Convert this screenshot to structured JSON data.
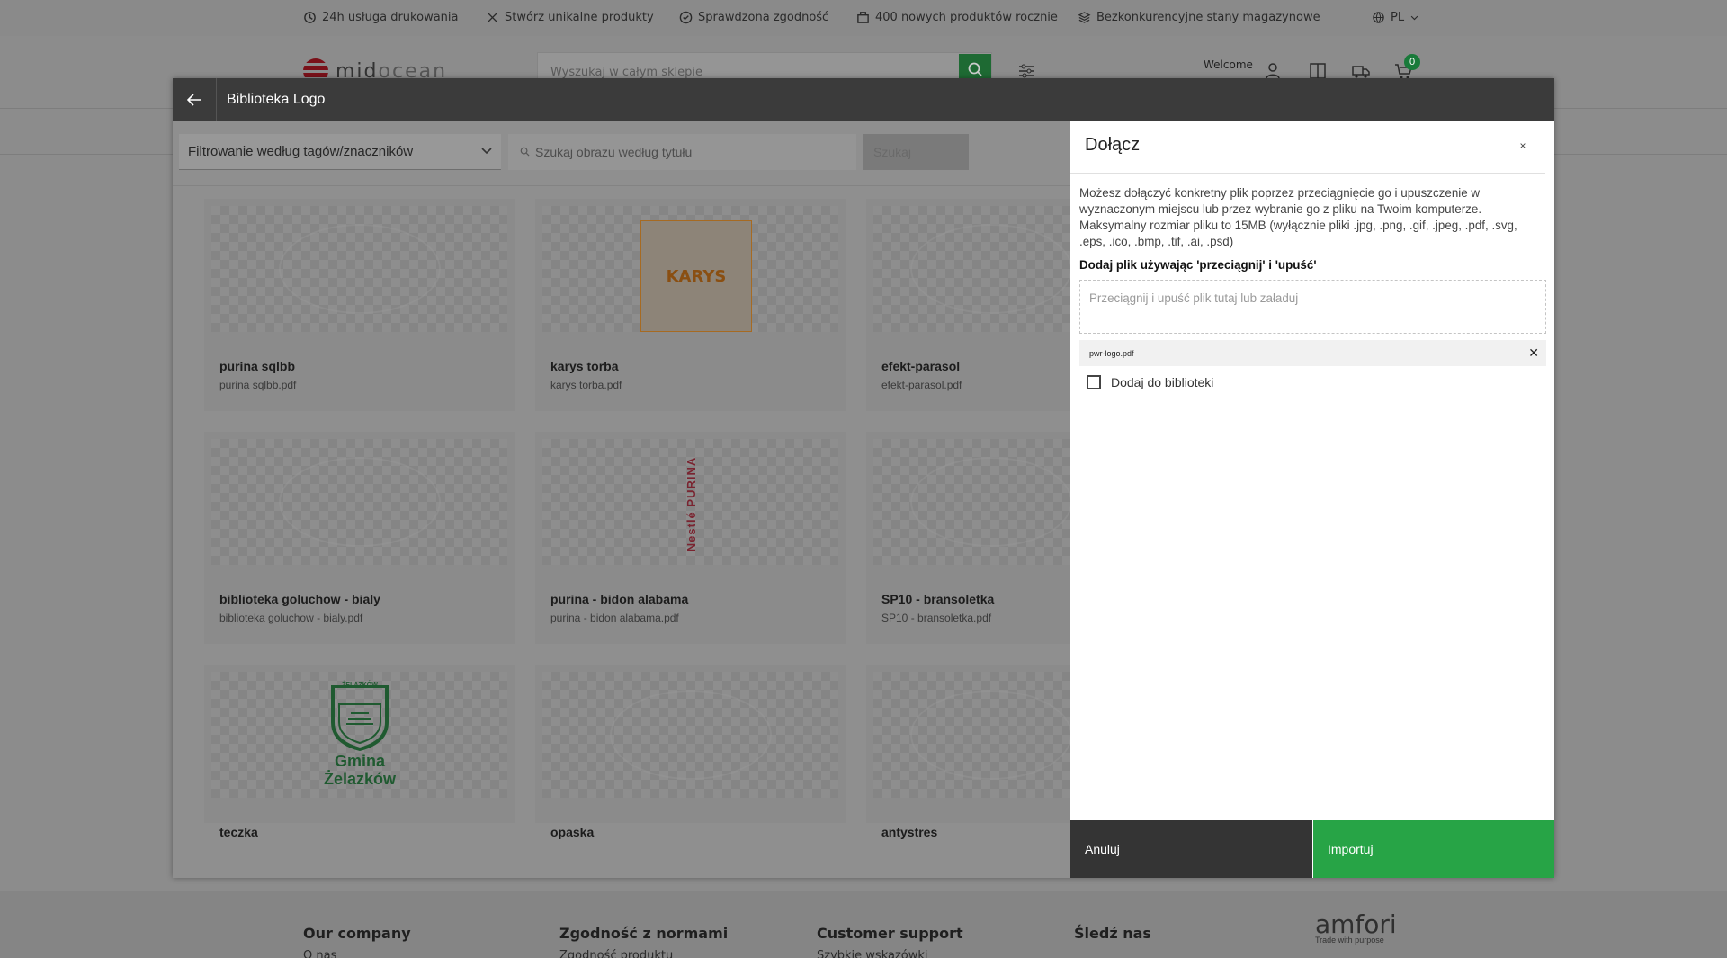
{
  "topbar": {
    "items": [
      {
        "icon": "clock-refresh-icon",
        "label": "24h usługa drukowania"
      },
      {
        "icon": "tools-icon",
        "label": "Stwórz unikalne produkty"
      },
      {
        "icon": "check-circle-icon",
        "label": "Sprawdzona zgodność"
      },
      {
        "icon": "new-box-icon",
        "label": "400 nowych produktów rocznie"
      },
      {
        "icon": "layers-icon",
        "label": "Bezkonkurencyjne stany magazynowe"
      }
    ],
    "language": "PL"
  },
  "header": {
    "logo_part1": "mid",
    "logo_part2": "ocean",
    "search_placeholder": "Wyszukaj w całym sklepie",
    "welcome": "Welcome",
    "cart_count": "0"
  },
  "modal": {
    "title": "Biblioteka Logo",
    "filter_label": "Filtrowanie według tagów/znaczników",
    "search_placeholder": "Szukaj obrazu według tytułu",
    "search_button": "Szukaj",
    "cards": [
      {
        "name": "purina sqlbb",
        "file": "purina sqlbb.pdf"
      },
      {
        "name": "karys torba",
        "file": "karys torba.pdf",
        "logo_text": "KARYS"
      },
      {
        "name": "efekt-parasol",
        "file": "efekt-parasol.pdf"
      },
      {
        "name": "biblioteka goluchow - bialy",
        "file": "biblioteka goluchow - bialy.pdf"
      },
      {
        "name": "purina - bidon alabama",
        "file": "purina - bidon alabama.pdf",
        "logo_text": "Nestlé PURINA"
      },
      {
        "name": "SP10 - bransoletka",
        "file": "SP10 - bransoletka.pdf"
      },
      {
        "name": "teczka",
        "file": "",
        "logo_top": "ŻELAZKÓW",
        "logo_line1": "Gmina",
        "logo_line2": "Żelazków"
      },
      {
        "name": "opaska",
        "file": ""
      },
      {
        "name": "antystres",
        "file": ""
      }
    ]
  },
  "panel": {
    "title": "Dołącz",
    "close_label": "×",
    "description": "Możesz dołączyć konkretny plik poprzez przeciągnięcie go i upuszczenie w wyznaczonym miejscu lub przez wybranie go z pliku na Twoim komputerze. Maksymalny rozmiar pliku to 15MB (wyłącznie pliki .jpg, .png, .gif, .jpeg, .pdf, .svg, .eps, .ico, .bmp, .tif, .ai, .psd)",
    "subheading": "Dodaj plik używając 'przeciągnij' i 'upuść'",
    "dropzone_text": "Przeciągnij i upuść plik tutaj lub załaduj",
    "attached_file": "pwr-logo.pdf",
    "checkbox_label": "Dodaj do biblioteki",
    "cancel_button": "Anuluj",
    "import_button": "Importuj"
  },
  "footer": {
    "columns": [
      "Our company",
      "Zgodność z normami",
      "Customer support",
      "Śledź nas"
    ],
    "subitems": [
      "O nas",
      "Zgodność produktu",
      "Szybkie wskazówki"
    ],
    "partner_logo": "amfori",
    "partner_tagline": "Trade with purpose"
  },
  "colors": {
    "header_dark": "#3b3b3b",
    "import_green": "#27a446",
    "cancel_dark": "#343434",
    "karys_orange": "#d98a2b",
    "purina_red": "#c8102e",
    "gmina_green": "#1d8a3a"
  }
}
